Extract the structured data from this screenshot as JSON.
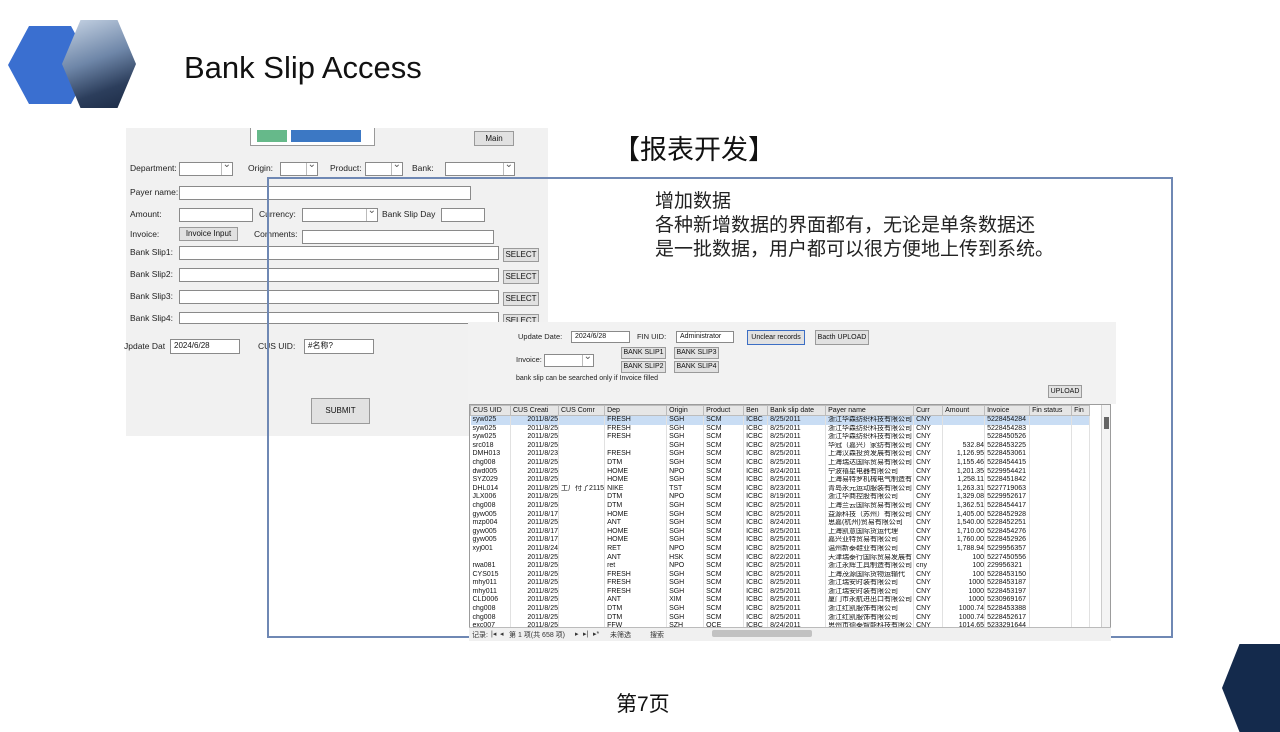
{
  "slide": {
    "title": "Bank Slip Access",
    "section_heading": "【报表开发】",
    "description": [
      "增加数据",
      "各种新增数据的界面都有，无论是单条数据还",
      "是一批数据，用户都可以很方便地上传到系统。"
    ],
    "page_number": "第7页"
  },
  "form": {
    "main_button": "Main",
    "department_label": "Department:",
    "origin_label": "Origin:",
    "product_label": "Product:",
    "bank_label": "Bank:",
    "payer_name_label": "Payer name:",
    "amount_label": "Amount:",
    "currency_label": "Currency:",
    "bank_slip_day_label": "Bank Slip Day",
    "invoice_label": "Invoice:",
    "invoice_input_button": "Invoice Input",
    "comments_label": "Comments:",
    "bank_slip1_label": "Bank Slip1:",
    "bank_slip2_label": "Bank Slip2:",
    "bank_slip3_label": "Bank Slip3:",
    "bank_slip4_label": "Bank Slip4:",
    "select_button": "SELECT",
    "update_date_label": "Jpdate Dat",
    "update_date_value": "2024/6/28",
    "cus_uid_label": "CUS UID:",
    "cus_uid_value": "#名称?",
    "submit_button": "SUBMIT"
  },
  "upload": {
    "update_date_label": "Update Date:",
    "update_date_value": "2024/6/28",
    "fin_uid_label": "FIN UID:",
    "fin_uid_value": "Administrator",
    "unclear_button": "Unclear records",
    "batch_upload_button": "Bacth UPLOAD",
    "invoice_label": "Invoice:",
    "bank_slip1_button": "BANK SLIP1",
    "bank_slip2_button": "BANK SLIP2",
    "bank_slip3_button": "BANK SLIP3",
    "bank_slip4_button": "BANK SLIP4",
    "note": "bank slip can be searched only if Invoice filled",
    "upload_button": "UPLOAD"
  },
  "grid": {
    "columns": [
      "CUS UID",
      "CUS Creati",
      "CUS Comr",
      "Dep",
      "Origin",
      "Product",
      "Ben",
      "Bank slip date",
      "Payer name",
      "Curr",
      "Amount",
      "Invoice",
      "Fin status",
      "Fin"
    ],
    "rows": [
      [
        "syw025",
        "2011/8/25",
        "",
        "FRESH",
        "SGH",
        "SCM",
        "ICBC",
        "8/25/2011",
        "浙江华森纺织科技有限公司",
        "CNY",
        "",
        "5228454284",
        "",
        ""
      ],
      [
        "syw025",
        "2011/8/25",
        "",
        "FRESH",
        "SGH",
        "SCM",
        "ICBC",
        "8/25/2011",
        "浙江华森纺织科技有限公司",
        "CNY",
        "",
        "5228454283",
        "",
        ""
      ],
      [
        "syw025",
        "2011/8/25",
        "",
        "FRESH",
        "SGH",
        "SCM",
        "ICBC",
        "8/25/2011",
        "浙江华森纺织科技有限公司",
        "CNY",
        "",
        "5228450526",
        "",
        ""
      ],
      [
        "src018",
        "2011/8/25",
        "",
        "",
        "SGH",
        "SCM",
        "ICBC",
        "8/25/2011",
        "华冠（嘉兴）家纺有限公司",
        "CNY",
        "532.84",
        "5228453225",
        "",
        ""
      ],
      [
        "DMH013",
        "2011/8/23",
        "",
        "FRESH",
        "SGH",
        "SCM",
        "ICBC",
        "8/25/2011",
        "上海汉森投资发展有限公司",
        "CNY",
        "1,126.95",
        "5228453061",
        "",
        ""
      ],
      [
        "chg008",
        "2011/8/25",
        "",
        "DTM",
        "SGH",
        "SCM",
        "ICBC",
        "8/25/2011",
        "上海瑞达国际贸易有限公司",
        "CNY",
        "1,155.46",
        "5228454415",
        "",
        ""
      ],
      [
        "dwd005",
        "2011/8/25",
        "",
        "HOME",
        "NPO",
        "SCM",
        "ICBC",
        "8/24/2011",
        "宁波禧星电器有限公司",
        "CNY",
        "1,201.35",
        "5229954421",
        "",
        ""
      ],
      [
        "SYZ029",
        "2011/8/25",
        "",
        "HOME",
        "SGH",
        "SCM",
        "ICBC",
        "8/25/2011",
        "上海易特罗机械电气制造有",
        "CNY",
        "1,258.11",
        "5228451842",
        "",
        ""
      ],
      [
        "DHL014",
        "2011/8/25",
        "工厂付了2115",
        "NIKE",
        "TST",
        "SCM",
        "ICBC",
        "8/23/2011",
        "青岛永元运动服装有限公司",
        "CNY",
        "1,263.31",
        "5227719063",
        "",
        ""
      ],
      [
        "JLX006",
        "2011/8/25",
        "",
        "DTM",
        "NPO",
        "SCM",
        "ICBC",
        "8/19/2011",
        "浙江华商控股有限公司",
        "CNY",
        "1,329.08",
        "5229952617",
        "",
        ""
      ],
      [
        "chg008",
        "2011/8/25",
        "",
        "DTM",
        "SGH",
        "SCM",
        "ICBC",
        "8/25/2011",
        "上海兰云国际贸易有限公司",
        "CNY",
        "1,362.51",
        "5228454417",
        "",
        ""
      ],
      [
        "gyw005",
        "2011/8/17",
        "",
        "HOME",
        "SGH",
        "SCM",
        "ICBC",
        "8/25/2011",
        "益源科技（苏州）有限公司",
        "CNY",
        "1,405.00",
        "5228452928",
        "",
        ""
      ],
      [
        "mzp004",
        "2011/8/25",
        "",
        "ANT",
        "SGH",
        "SCM",
        "ICBC",
        "8/24/2011",
        "思嘉(杭州)贸易有限公司",
        "CNY",
        "1,540.00",
        "5228452251",
        "",
        ""
      ],
      [
        "gyw005",
        "2011/8/17",
        "",
        "HOME",
        "SGH",
        "SCM",
        "ICBC",
        "8/25/2011",
        "上海凯意国际货运代理",
        "CNY",
        "1,710.00",
        "5228454276",
        "",
        ""
      ],
      [
        "gyw005",
        "2011/8/17",
        "",
        "HOME",
        "SGH",
        "SCM",
        "ICBC",
        "8/25/2011",
        "嘉兴亚特贸易有限公司",
        "CNY",
        "1,760.00",
        "5228452926",
        "",
        ""
      ],
      [
        "xyj001",
        "2011/8/24",
        "",
        "RET",
        "NPO",
        "SCM",
        "ICBC",
        "8/25/2011",
        "温州新泰鞋业有限公司",
        "CNY",
        "1,788.94",
        "5229956357",
        "",
        ""
      ],
      [
        "",
        "2011/8/25",
        "",
        "ANT",
        "HSK",
        "SCM",
        "ICBC",
        "8/22/2011",
        "天津瑞泰行国际贸易发展有",
        "CNY",
        "100",
        "5227450556",
        "",
        ""
      ],
      [
        "rwa081",
        "2011/8/25",
        "",
        "ret",
        "NPO",
        "SCM",
        "ICBC",
        "8/25/2011",
        "浙江永辉工具制造有限公司",
        "cny",
        "100",
        "229956321",
        "",
        ""
      ],
      [
        "CYS015",
        "2011/8/25",
        "",
        "FRESH",
        "SGH",
        "SCM",
        "ICBC",
        "8/25/2011",
        "上海茂源国际货物运输代",
        "CNY",
        "100",
        "5228453150",
        "",
        ""
      ],
      [
        "mhy011",
        "2011/8/25",
        "",
        "FRESH",
        "SGH",
        "SCM",
        "ICBC",
        "8/25/2011",
        "浙江瑞安时装有限公司",
        "CNY",
        "1000",
        "5228453187",
        "",
        ""
      ],
      [
        "mhy011",
        "2011/8/25",
        "",
        "FRESH",
        "SGH",
        "SCM",
        "ICBC",
        "8/25/2011",
        "浙江瑞安时装有限公司",
        "CNY",
        "1000",
        "5228453197",
        "",
        ""
      ],
      [
        "CLD006",
        "2011/8/25",
        "",
        "ANT",
        "XIM",
        "SCM",
        "ICBC",
        "8/25/2011",
        "厦门市永航进出口有限公司",
        "CNY",
        "1000",
        "5230969167",
        "",
        ""
      ],
      [
        "chg008",
        "2011/8/25",
        "",
        "DTM",
        "SGH",
        "SCM",
        "ICBC",
        "8/25/2011",
        "浙江红凯服饰有限公司",
        "CNY",
        "1000.74",
        "5228453388",
        "",
        ""
      ],
      [
        "chg008",
        "2011/8/25",
        "",
        "DTM",
        "SGH",
        "SCM",
        "ICBC",
        "8/25/2011",
        "浙江红凯服饰有限公司",
        "CNY",
        "1000.74",
        "5228452617",
        "",
        ""
      ],
      [
        "exc007",
        "2011/8/25",
        "",
        "FFW",
        "SZH",
        "OCE",
        "ICBC",
        "8/24/2011",
        "思州市德泰智能科技有限公",
        "CNY",
        "1014.65",
        "5233291644",
        "",
        ""
      ]
    ],
    "footer": {
      "record_label": "记录:",
      "nav_first": "|◂",
      "nav_prev": "◂",
      "position": "第 1 项(共 658 项)",
      "nav_next": "▸",
      "nav_last": "▸|",
      "nav_new": "▸*",
      "filter": "未筛选",
      "search": "搜索"
    }
  }
}
